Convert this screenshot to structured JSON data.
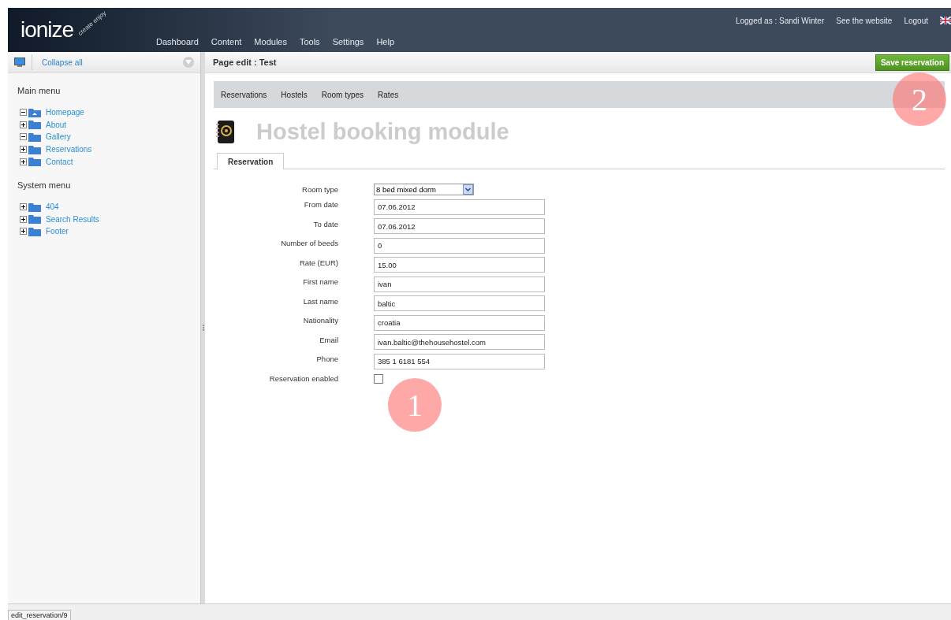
{
  "header": {
    "logo": "ionize",
    "logo_tagline": "create enjoy",
    "nav": [
      "Dashboard",
      "Content",
      "Modules",
      "Tools",
      "Settings",
      "Help"
    ],
    "user": "Logged as : Sandi Winter",
    "links": [
      "See the website",
      "Logout"
    ]
  },
  "sidebar": {
    "collapse_label": "Collapse all",
    "sections": [
      {
        "title": "Main menu",
        "items": [
          {
            "label": "Homepage",
            "expanded": true,
            "kind": "home"
          },
          {
            "label": "About",
            "expanded": false,
            "kind": "folder"
          },
          {
            "label": "Gallery",
            "expanded": true,
            "kind": "folder"
          },
          {
            "label": "Reservations",
            "expanded": false,
            "kind": "folder"
          },
          {
            "label": "Contact",
            "expanded": false,
            "kind": "folder"
          }
        ]
      },
      {
        "title": "System menu",
        "items": [
          {
            "label": "404",
            "expanded": false,
            "kind": "folder"
          },
          {
            "label": "Search Results",
            "expanded": false,
            "kind": "folder"
          },
          {
            "label": "Footer",
            "expanded": false,
            "kind": "folder"
          }
        ]
      }
    ]
  },
  "page": {
    "title": "Page edit : Test",
    "save_button": "Save reservation",
    "module_tabs": [
      "Reservations",
      "Hostels",
      "Room types",
      "Rates"
    ],
    "heading": "Hostel booking module",
    "tabs": [
      {
        "label": "Reservation",
        "selected": true
      }
    ],
    "fields": [
      {
        "label": "Room type",
        "kind": "select",
        "value": "8 bed mixed dorm"
      },
      {
        "label": "From date",
        "kind": "text",
        "value": "07.06.2012"
      },
      {
        "label": "To date",
        "kind": "text",
        "value": "07.06.2012"
      },
      {
        "label": "Number of beeds",
        "kind": "text",
        "value": "0"
      },
      {
        "label": "Rate (EUR)",
        "kind": "text",
        "value": "15.00"
      },
      {
        "label": "First name",
        "kind": "text",
        "value": "ivan"
      },
      {
        "label": "Last name",
        "kind": "text",
        "value": "baltic"
      },
      {
        "label": "Nationality",
        "kind": "text",
        "value": "croatia"
      },
      {
        "label": "Email",
        "kind": "text",
        "value": "ivan.baltic@thehousehostel.com"
      },
      {
        "label": "Phone",
        "kind": "text",
        "value": "385 1 6181 554"
      },
      {
        "label": "Reservation enabled",
        "kind": "checkbox",
        "checked": false
      }
    ]
  },
  "callouts": [
    "1",
    "2"
  ],
  "status_bar": "edit_reservation/9"
}
